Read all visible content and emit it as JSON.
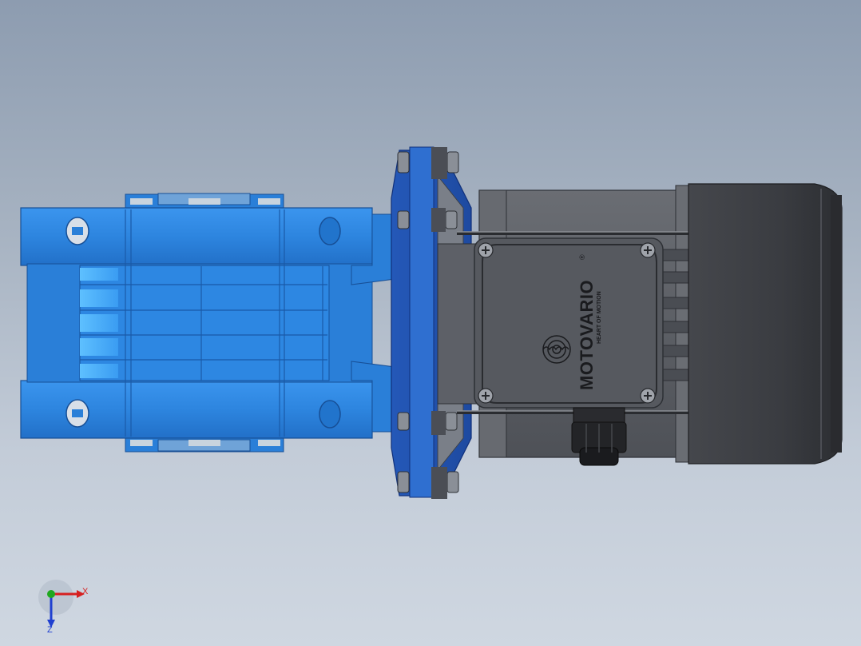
{
  "viewport": {
    "background_top": "#8d9cb0",
    "background_bottom": "#cfd7e1"
  },
  "model": {
    "parts": [
      {
        "name": "worm-gearbox-housing",
        "color": "#2a86e0"
      },
      {
        "name": "output-flange",
        "color": "#2f6fd0"
      },
      {
        "name": "motor-frame",
        "color": "#5a5d63"
      },
      {
        "name": "terminal-box-cover",
        "color": "#4d5056"
      },
      {
        "name": "fan-cover",
        "color": "#3a3c40"
      },
      {
        "name": "cable-gland",
        "color": "#1e1f22"
      }
    ],
    "brand": "MOTOVARIO",
    "brand_mark": "®",
    "tagline": "HEART OF MOTION"
  },
  "triad": {
    "x_label": "X",
    "z_label": "Z",
    "x_color": "#d62020",
    "y_color": "#1fa81f",
    "z_color": "#2040d0"
  }
}
